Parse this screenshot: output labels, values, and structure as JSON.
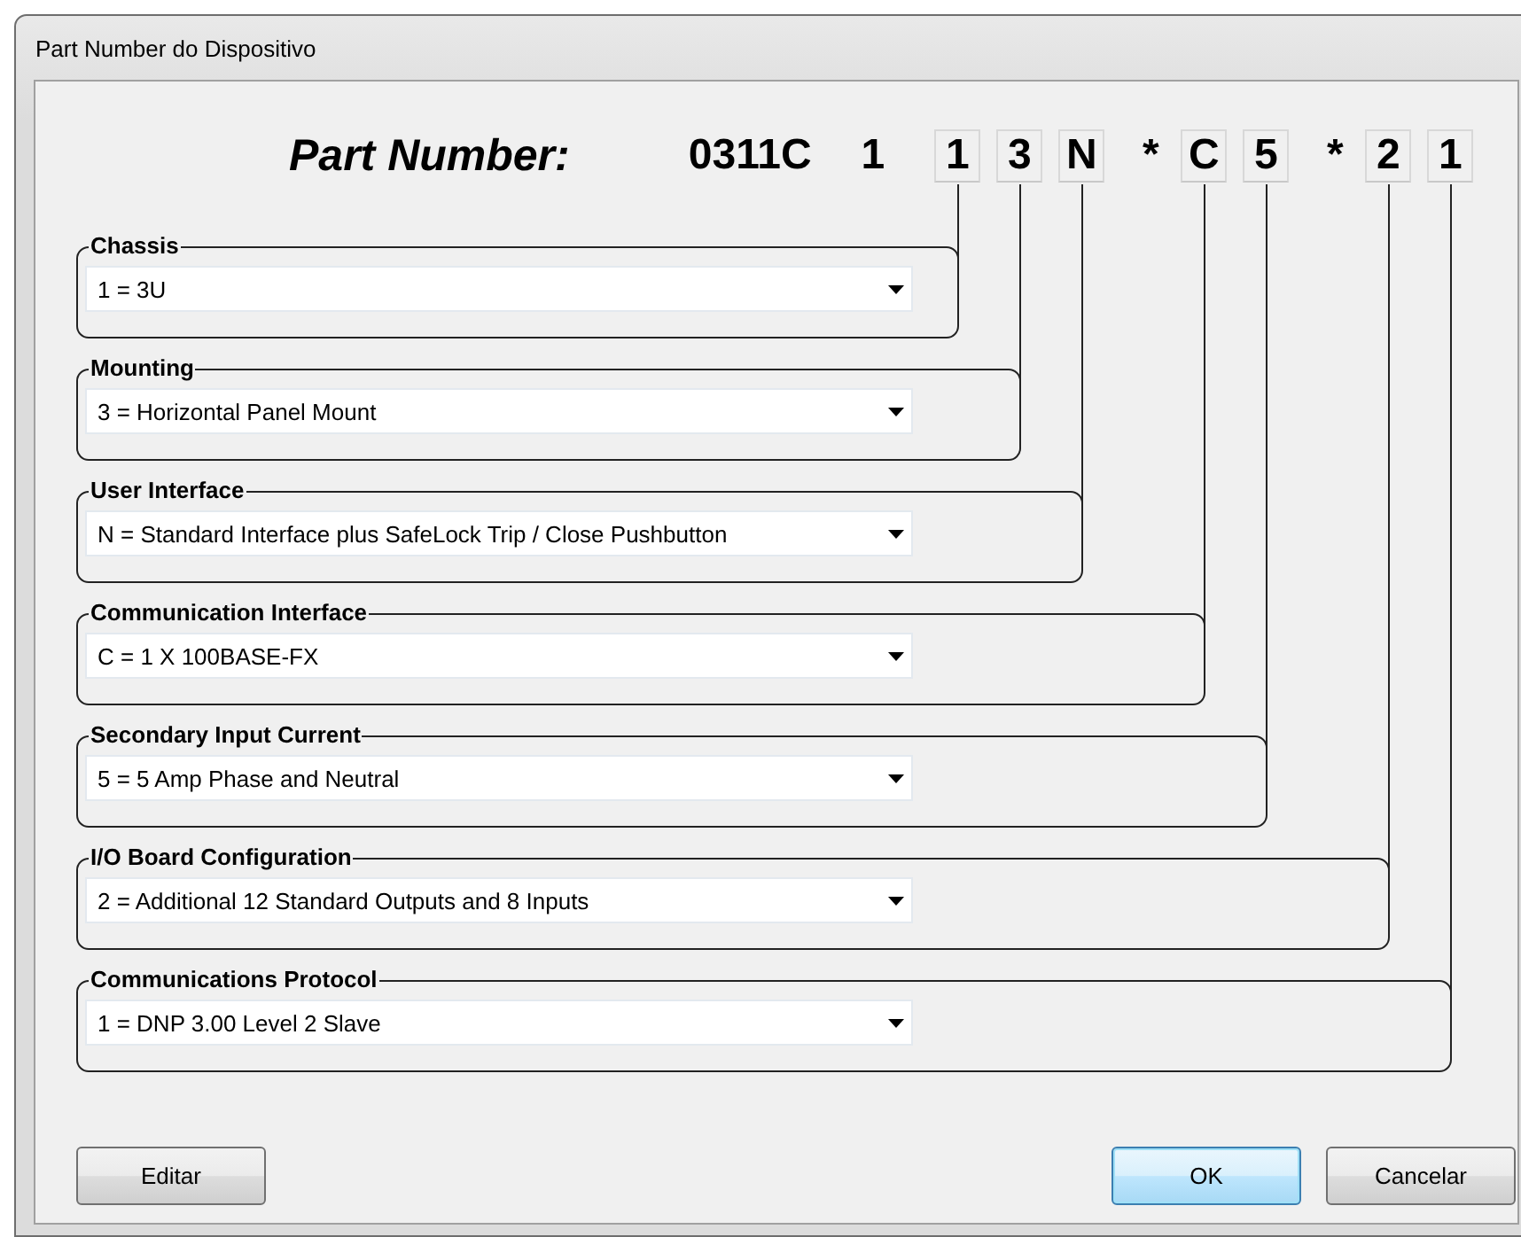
{
  "window": {
    "title": "Part Number do Dispositivo"
  },
  "part_number": {
    "label": "Part Number:",
    "segments": [
      {
        "text": "0311C",
        "boxed": false
      },
      {
        "text": "1",
        "boxed": false
      },
      {
        "text": "1",
        "boxed": true
      },
      {
        "text": "3",
        "boxed": true
      },
      {
        "text": "N",
        "boxed": true
      },
      {
        "text": "*",
        "boxed": false
      },
      {
        "text": "C",
        "boxed": true
      },
      {
        "text": "5",
        "boxed": true
      },
      {
        "text": "*",
        "boxed": false
      },
      {
        "text": "2",
        "boxed": true
      },
      {
        "text": "1",
        "boxed": true
      }
    ]
  },
  "groups": [
    {
      "title": "Chassis",
      "value": "1 = 3U"
    },
    {
      "title": "Mounting",
      "value": "3 = Horizontal Panel Mount"
    },
    {
      "title": "User Interface",
      "value": "N = Standard Interface plus SafeLock Trip / Close Pushbutton"
    },
    {
      "title": "Communication Interface",
      "value": "C = 1 X 100BASE-FX"
    },
    {
      "title": "Secondary Input Current",
      "value": "5 = 5 Amp Phase and Neutral"
    },
    {
      "title": "I/O Board Configuration",
      "value": "2 = Additional 12 Standard Outputs and 8 Inputs"
    },
    {
      "title": "Communications Protocol",
      "value": "1 = DNP 3.00 Level 2 Slave"
    }
  ],
  "buttons": [
    {
      "label": "Editar",
      "kind": "left",
      "default": false
    },
    {
      "label": "OK",
      "kind": "right",
      "default": true
    },
    {
      "label": "Cancelar",
      "kind": "right",
      "default": false
    }
  ]
}
